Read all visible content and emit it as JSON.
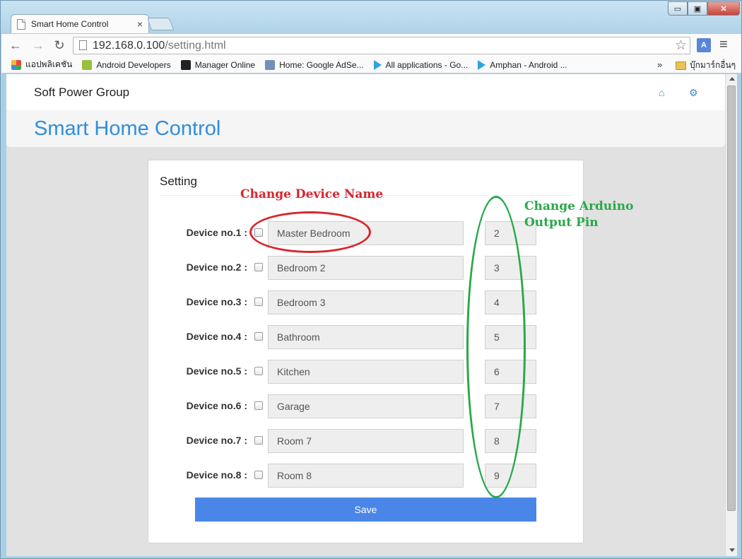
{
  "browser": {
    "tab_title": "Smart Home Control",
    "tab_close": "×",
    "url_host": "192.168.0.100",
    "url_path": "/setting.html",
    "window_controls": {
      "minimize": "▭",
      "maximize": "▣",
      "close": "✕"
    },
    "nav": {
      "back": "←",
      "forward": "→",
      "reload": "↻"
    },
    "star": "☆",
    "translate_label": "A",
    "menu": "≡",
    "bookmarks": [
      {
        "label": "แอปพลิเคชัน",
        "icon": "apps-icon"
      },
      {
        "label": "Android Developers",
        "icon": "android-icon"
      },
      {
        "label": "Manager Online",
        "icon": "manager-icon"
      },
      {
        "label": "Home: Google AdSe...",
        "icon": "adsense-icon"
      },
      {
        "label": "All applications - Go...",
        "icon": "play-icon"
      },
      {
        "label": "Amphan - Android ...",
        "icon": "play-icon"
      }
    ],
    "bookmarks_more": "»",
    "other_bookmarks": "บุ๊กมาร์กอื่นๆ"
  },
  "site": {
    "brand": "Soft Power Group",
    "heading": "Smart Home Control",
    "home_icon": "⌂",
    "settings_icon": "⚙"
  },
  "setting": {
    "title": "Setting",
    "devices": [
      {
        "label": "Device no.1 :",
        "name": "Master Bedroom",
        "pin": "2"
      },
      {
        "label": "Device no.2 :",
        "name": "Bedroom 2",
        "pin": "3"
      },
      {
        "label": "Device no.3 :",
        "name": "Bedroom 3",
        "pin": "4"
      },
      {
        "label": "Device no.4 :",
        "name": "Bathroom",
        "pin": "5"
      },
      {
        "label": "Device no.5 :",
        "name": "Kitchen",
        "pin": "6"
      },
      {
        "label": "Device no.6 :",
        "name": "Garage",
        "pin": "7"
      },
      {
        "label": "Device no.7 :",
        "name": "Room 7",
        "pin": "8"
      },
      {
        "label": "Device no.8 :",
        "name": "Room 8",
        "pin": "9"
      }
    ],
    "save_label": "Save"
  },
  "annotations": {
    "device_name": "Change Device Name",
    "pin_line1": "Change Arduino",
    "pin_line2": "Output Pin",
    "red": "#d8262f",
    "green": "#2aa84a"
  }
}
